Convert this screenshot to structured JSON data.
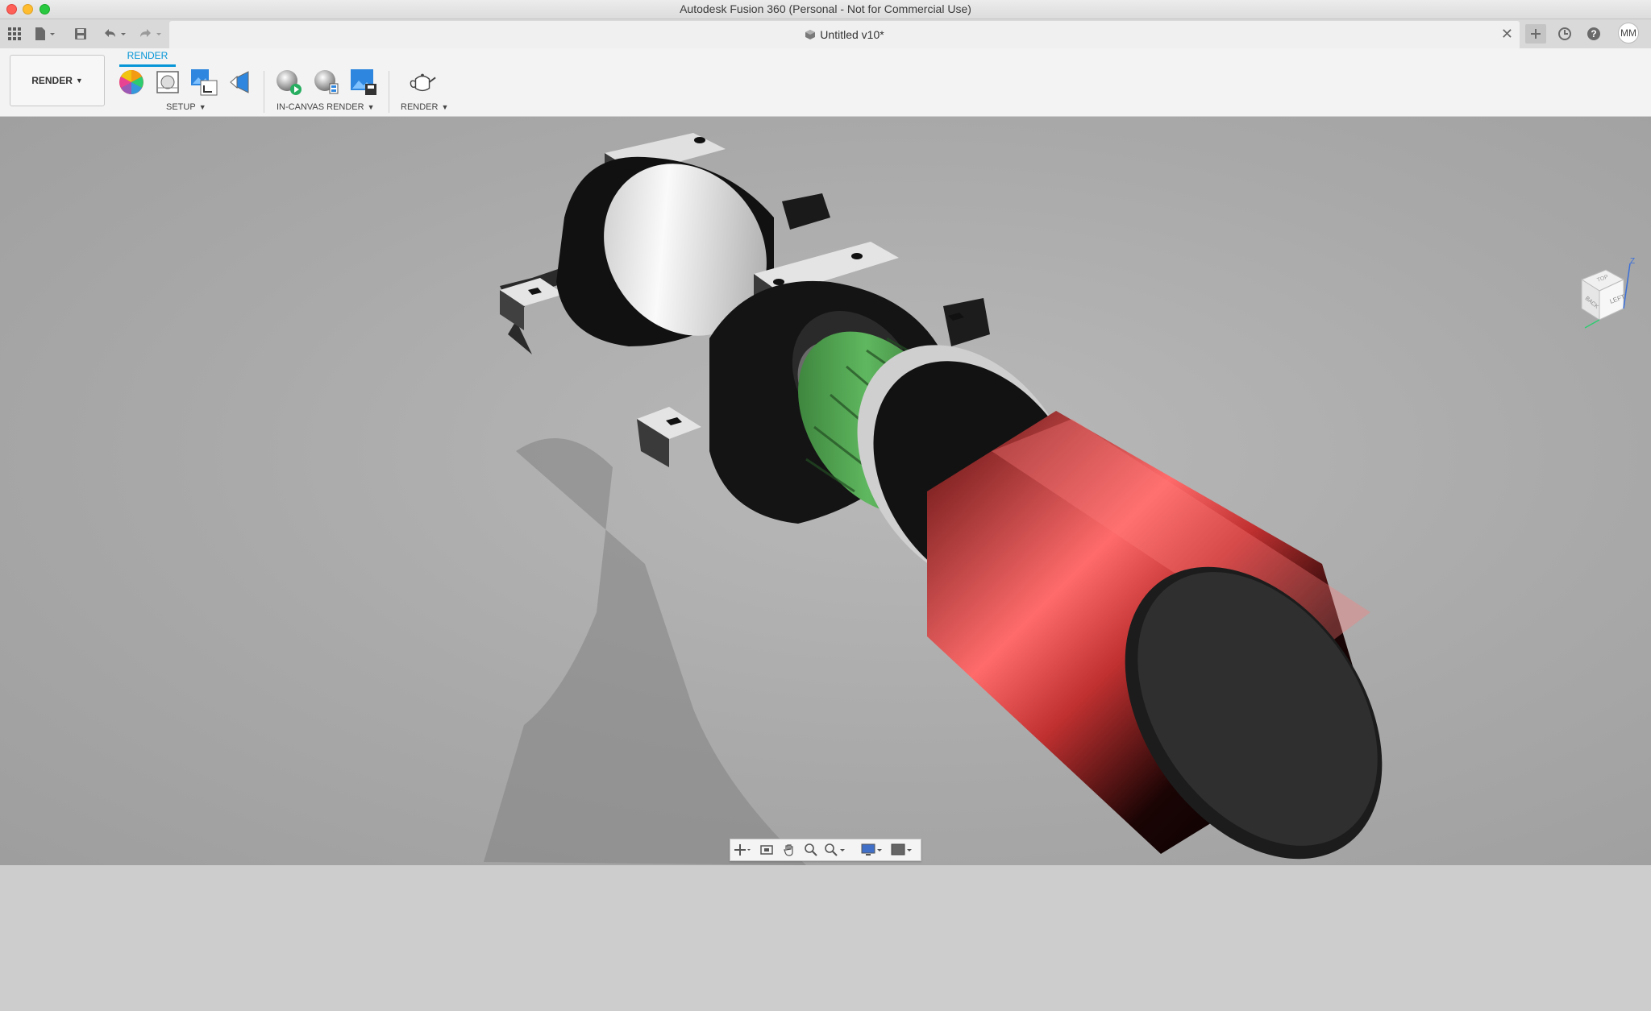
{
  "window": {
    "title": "Autodesk Fusion 360 (Personal - Not for Commercial Use)"
  },
  "document_tab": {
    "title": "Untitled v10*",
    "close_symbol": "✕"
  },
  "quick_access": {
    "icons": [
      "grid-menu-icon",
      "file-icon",
      "save-icon",
      "undo-icon",
      "redo-icon"
    ]
  },
  "right_toolbar": {
    "icons": [
      "new-tab-icon",
      "job-status-icon",
      "help-icon"
    ],
    "user_initials": "MM"
  },
  "ribbon": {
    "workspace_label": "RENDER",
    "active_tab": "RENDER",
    "groups": [
      {
        "label": "SETUP",
        "tools": [
          "appearance-icon",
          "scene-settings-icon",
          "texture-map-icon",
          "decal-icon"
        ]
      },
      {
        "label": "IN-CANVAS RENDER",
        "tools": [
          "in-canvas-render-icon",
          "in-canvas-settings-icon",
          "capture-image-icon"
        ]
      },
      {
        "label": "RENDER",
        "tools": [
          "render-teapot-icon"
        ]
      }
    ]
  },
  "viewcube": {
    "faces": [
      "LEFT",
      "BACK",
      "TOP"
    ],
    "axis_label": "Z"
  },
  "colors": {
    "accent": "#0696d7",
    "viewport_bg": "#a9a9a9",
    "model_red": "#d43a3a",
    "model_green": "#3e8f3e",
    "model_white": "#e9e9e9"
  },
  "navigation_bar": {
    "icons": [
      "orbit-icon",
      "look-at-icon",
      "pan-icon",
      "zoom-icon",
      "zoom-window-icon",
      "display-settings-icon",
      "visual-style-icon"
    ]
  }
}
